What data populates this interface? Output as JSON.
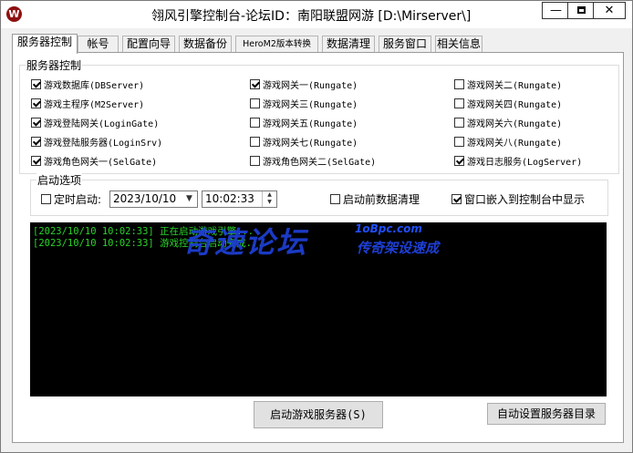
{
  "window": {
    "title": "翎风引擎控制台-论坛ID：南阳联盟网游 [D:\\Mirserver\\]",
    "icon": "app-logo-icon",
    "minimize_label": "—",
    "close_label": "✕"
  },
  "tabs": [
    {
      "label": "服务器控制",
      "active": true
    },
    {
      "label": "帐号"
    },
    {
      "label": "配置向导"
    },
    {
      "label": "数据备份"
    },
    {
      "label": "HeroM2版本转换"
    },
    {
      "label": "数据清理"
    },
    {
      "label": "服务窗口"
    },
    {
      "label": "相关信息"
    }
  ],
  "server_control": {
    "group_title": "服务器控制",
    "checkboxes": [
      {
        "label": "游戏数据库(DBServer)",
        "checked": true
      },
      {
        "label": "游戏网关一(Rungate)",
        "checked": true
      },
      {
        "label": "游戏网关二(Rungate)",
        "checked": false
      },
      {
        "label": "游戏主程序(M2Server)",
        "checked": true
      },
      {
        "label": "游戏网关三(Rungate)",
        "checked": false
      },
      {
        "label": "游戏网关四(Rungate)",
        "checked": false
      },
      {
        "label": "游戏登陆网关(LoginGate)",
        "checked": true
      },
      {
        "label": "游戏网关五(Rungate)",
        "checked": false
      },
      {
        "label": "游戏网关六(Rungate)",
        "checked": false
      },
      {
        "label": "游戏登陆服务器(LoginSrv)",
        "checked": true
      },
      {
        "label": "游戏网关七(Rungate)",
        "checked": false
      },
      {
        "label": "游戏网关八(Rungate)",
        "checked": false
      },
      {
        "label": "游戏角色网关一(SelGate)",
        "checked": true
      },
      {
        "label": "游戏角色网关二(SelGate)",
        "checked": false
      },
      {
        "label": "游戏日志服务(LogServer)",
        "checked": true
      }
    ]
  },
  "startup_options": {
    "group_title": "启动选项",
    "timed_start": {
      "label": "定时启动:",
      "checked": false
    },
    "date_value": "2023/10/10",
    "time_value": "10:02:33",
    "clean_before_start": {
      "label": "启动前数据清理",
      "checked": false
    },
    "embed_window": {
      "label": "窗口嵌入到控制台中显示",
      "checked": true
    }
  },
  "console": {
    "lines": [
      "[2023/10/10 10:02:33] 正在启动游戏引擎...",
      "[2023/10/10 10:02:33] 游戏控制台启动完成..."
    ],
    "text_color": "#2ad42a"
  },
  "watermark": {
    "main": "奇速论坛",
    "url": "1oBpc.com",
    "sub": "传奇架设速成"
  },
  "buttons": {
    "start_server": "启动游戏服务器(S)",
    "auto_set_dir": "自动设置服务器目录"
  }
}
